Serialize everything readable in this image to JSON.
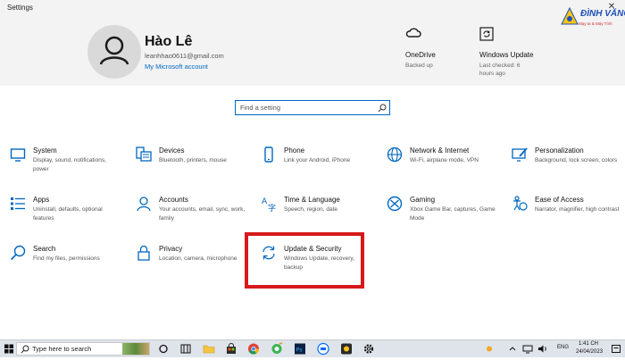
{
  "window": {
    "title": "Settings",
    "close_glyph": "✕"
  },
  "account": {
    "name": "Hào Lê",
    "email": "leanhhao0611@gmail.com",
    "link": "My Microsoft account"
  },
  "header_tiles": [
    {
      "title": "OneDrive",
      "sub": "Backed up",
      "icon": "cloud-icon"
    },
    {
      "title": "Windows Update",
      "sub": "Last checked: 6 hours ago",
      "icon": "refresh-icon"
    }
  ],
  "watermark": {
    "text": "ĐÌNH VĂNG",
    "sub": "Mạy ta & Máy Tính"
  },
  "search": {
    "placeholder": "Find a setting"
  },
  "categories": [
    {
      "title": "System",
      "desc": "Display, sound, notifications, power",
      "icon": "monitor-icon"
    },
    {
      "title": "Devices",
      "desc": "Bluetooth, printers, mouse",
      "icon": "keyboard-icon"
    },
    {
      "title": "Phone",
      "desc": "Link your Android, iPhone",
      "icon": "phone-icon"
    },
    {
      "title": "Network & Internet",
      "desc": "Wi-Fi, airplane mode, VPN",
      "icon": "globe-icon"
    },
    {
      "title": "Personalization",
      "desc": "Background, lock screen, colors",
      "icon": "paintbrush-icon"
    },
    {
      "title": "Apps",
      "desc": "Uninstall, defaults, optional features",
      "icon": "apps-list-icon"
    },
    {
      "title": "Accounts",
      "desc": "Your accounts, email, sync, work, family",
      "icon": "person-icon"
    },
    {
      "title": "Time & Language",
      "desc": "Speech, region, date",
      "icon": "language-icon"
    },
    {
      "title": "Gaming",
      "desc": "Xbox Game Bar, captures, Game Mode",
      "icon": "xbox-icon"
    },
    {
      "title": "Ease of Access",
      "desc": "Narrator, magnifier, high contrast",
      "icon": "ease-of-access-icon"
    },
    {
      "title": "Search",
      "desc": "Find my files, permissions",
      "icon": "search-icon"
    },
    {
      "title": "Privacy",
      "desc": "Location, camera, microphone",
      "icon": "lock-icon"
    },
    {
      "title": "Update & Security",
      "desc": "Windows Update, recovery, backup",
      "icon": "update-icon"
    }
  ],
  "taskbar": {
    "search_placeholder": "Type here to search",
    "language": "ENG",
    "time": "1:41 CH",
    "date": "24/04/2023"
  },
  "colors": {
    "accent": "#0067c0",
    "highlight": "#d7191c",
    "header_bg": "#f3f3f3"
  }
}
